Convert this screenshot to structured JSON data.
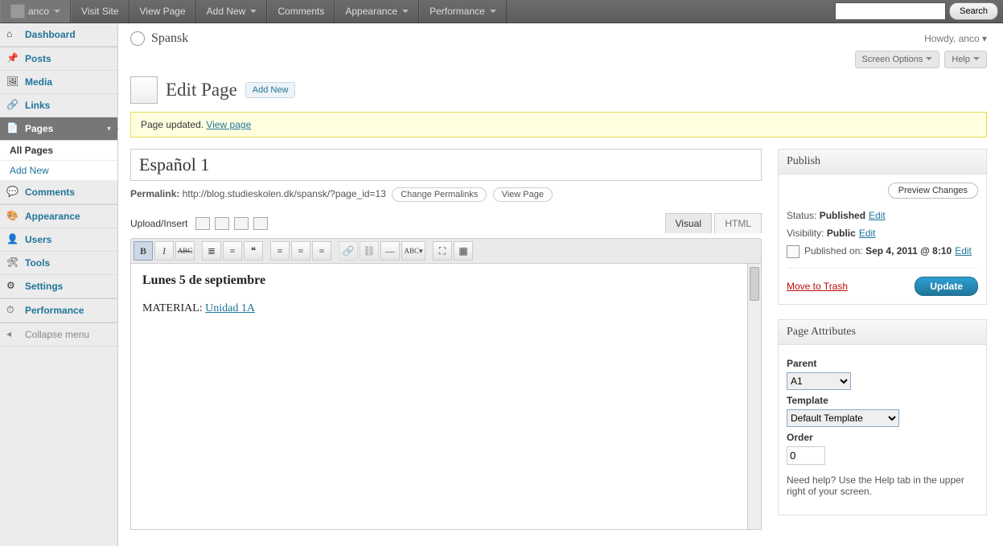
{
  "adminbar": {
    "user": "anco",
    "items": [
      "Visit Site",
      "View Page",
      "Add New",
      "Comments",
      "Appearance",
      "Performance"
    ],
    "search_button": "Search"
  },
  "header": {
    "site_title": "Spansk",
    "howdy": "Howdy, anco",
    "screen_options": "Screen Options",
    "help": "Help"
  },
  "page_head": {
    "title": "Edit Page",
    "add_new": "Add New"
  },
  "notice": {
    "text": "Page updated.",
    "link": "View page"
  },
  "sidebar": {
    "items": [
      {
        "label": "Dashboard",
        "icon": "dashboard-icon"
      },
      {
        "label": "Posts",
        "icon": "posts-icon"
      },
      {
        "label": "Media",
        "icon": "media-icon"
      },
      {
        "label": "Links",
        "icon": "links-icon"
      },
      {
        "label": "Pages",
        "icon": "pages-icon",
        "current": true,
        "sub": [
          {
            "label": "All Pages",
            "cur": true
          },
          {
            "label": "Add New"
          }
        ]
      },
      {
        "label": "Comments",
        "icon": "comments-icon"
      },
      {
        "label": "Appearance",
        "icon": "appearance-icon"
      },
      {
        "label": "Users",
        "icon": "users-icon"
      },
      {
        "label": "Tools",
        "icon": "tools-icon"
      },
      {
        "label": "Settings",
        "icon": "settings-icon"
      },
      {
        "label": "Performance",
        "icon": "performance-icon"
      }
    ],
    "collapse": "Collapse menu"
  },
  "editor": {
    "title_value": "Español 1",
    "permalink_label": "Permalink:",
    "permalink_url": "http://blog.studieskolen.dk/spansk/?page_id=13",
    "change_permalinks": "Change Permalinks",
    "view_page": "View Page",
    "upload_insert": "Upload/Insert",
    "tabs": {
      "visual": "Visual",
      "html": "HTML"
    },
    "content_heading": "Lunes 5 de septiembre",
    "content_text": "MATERIAL: ",
    "content_link": "Unidad 1A"
  },
  "publish": {
    "box_title": "Publish",
    "preview": "Preview Changes",
    "status_label": "Status:",
    "status_value": "Published",
    "visibility_label": "Visibility:",
    "visibility_value": "Public",
    "published_label": "Published on:",
    "published_value": "Sep 4, 2011 @ 8:10",
    "edit": "Edit",
    "trash": "Move to Trash",
    "update": "Update"
  },
  "page_attributes": {
    "box_title": "Page Attributes",
    "parent_label": "Parent",
    "parent_value": "A1",
    "template_label": "Template",
    "template_value": "Default Template",
    "order_label": "Order",
    "order_value": "0",
    "help_text": "Need help? Use the Help tab in the upper right of your screen."
  }
}
